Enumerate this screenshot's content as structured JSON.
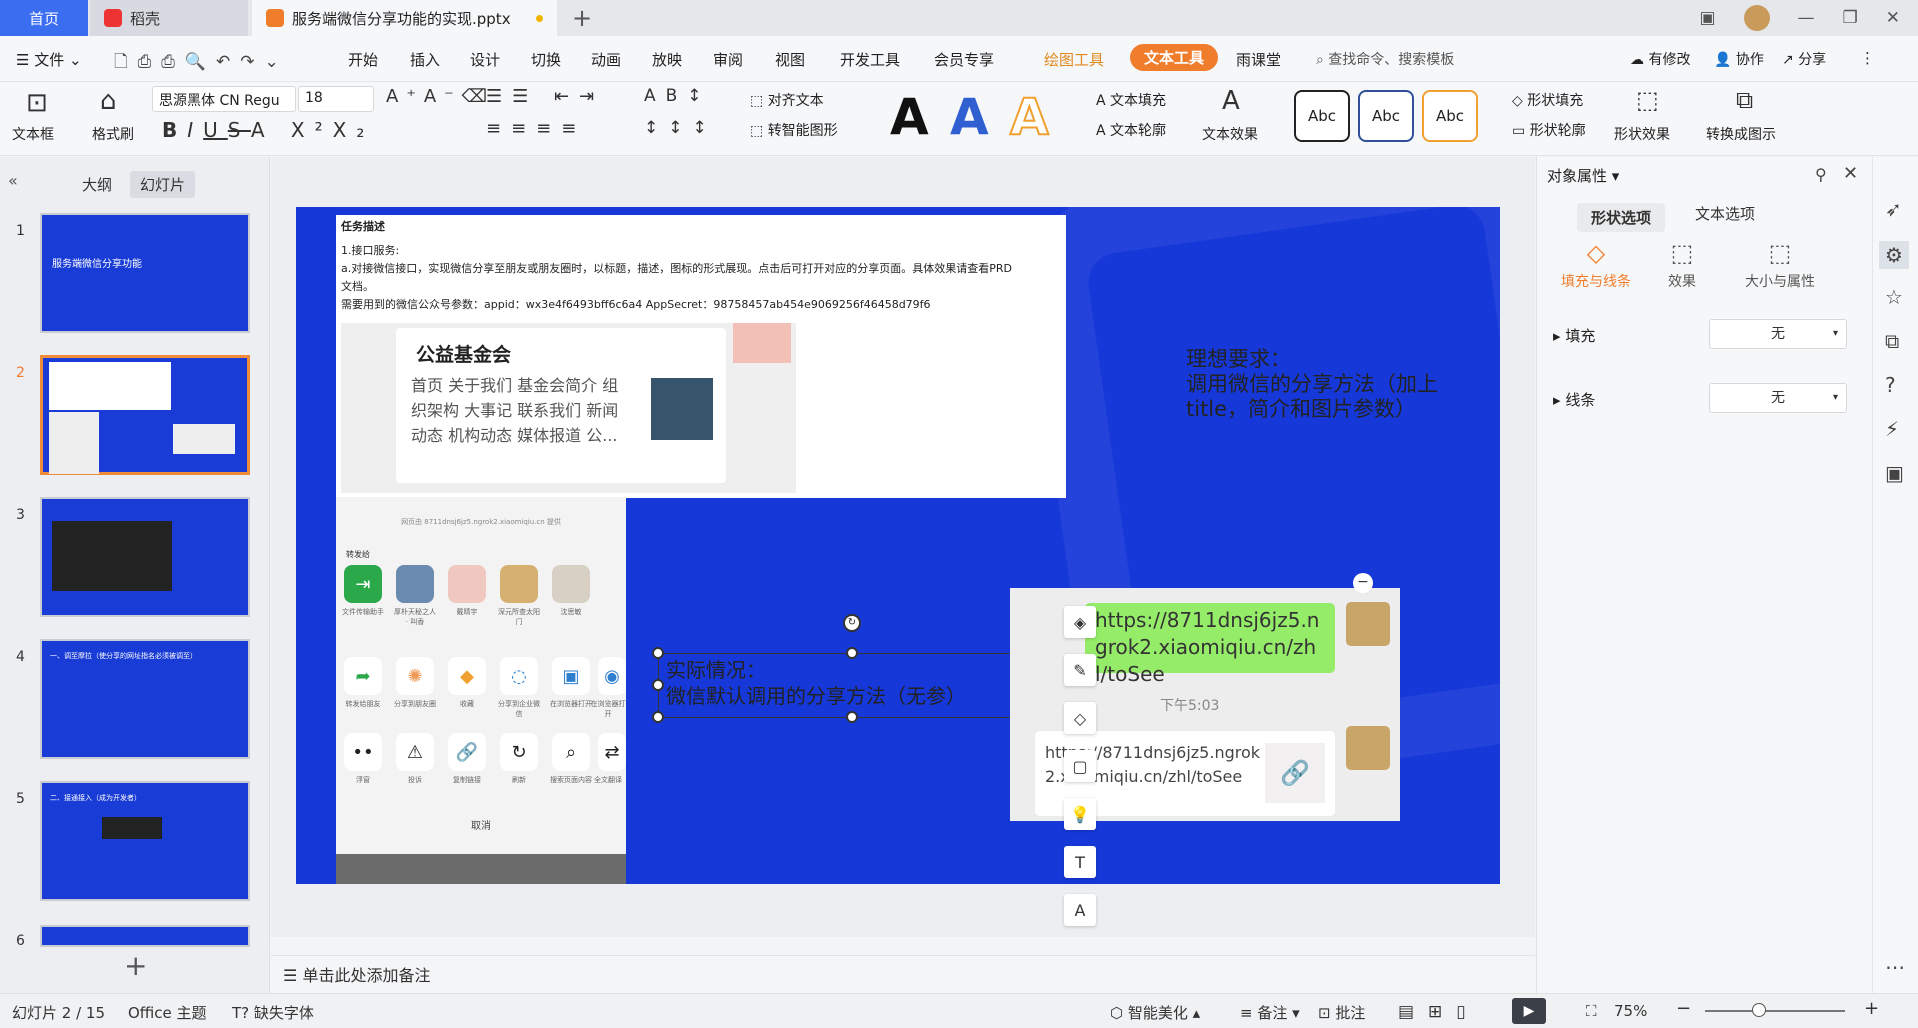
{
  "tabs": {
    "home": "首页",
    "daoke": "稻壳",
    "doc": "服务端微信分享功能的实现.pptx"
  },
  "menubar": {
    "file": "文件",
    "items": [
      "开始",
      "插入",
      "设计",
      "切换",
      "动画",
      "放映",
      "审阅",
      "视图",
      "开发工具",
      "会员专享"
    ],
    "draw_tool": "绘图工具",
    "text_tool": "文本工具",
    "classroom": "雨课堂",
    "search": "查找命令、搜索模板",
    "modified": "有修改",
    "collab": "协作",
    "share": "分享"
  },
  "ribbon": {
    "textbox": "文本框",
    "format_painter": "格式刷",
    "font": "思源黑体 CN Regu",
    "font_size": "18",
    "align_text": "对齐文本",
    "smart_shape": "转智能图形",
    "text_fill": "文本填充",
    "text_outline": "文本轮廓",
    "text_effect": "文本效果",
    "abc": [
      "Abc",
      "Abc",
      "Abc"
    ],
    "shape_fill": "形状填充",
    "shape_outline": "形状轮廓",
    "shape_effect": "形状效果",
    "convert_chart": "转换成图示",
    "big_a": "A"
  },
  "leftpanel": {
    "tab_outline": "大纲",
    "tab_slides": "幻灯片",
    "thumbs": [
      {
        "num": "1",
        "title": "服务端微信分享功能"
      },
      {
        "num": "2",
        "title": ""
      },
      {
        "num": "3",
        "title": ""
      },
      {
        "num": "4",
        "title": "一、调至摩拉（使分享的网址指名必须被调至）"
      },
      {
        "num": "5",
        "title": "二、接通接入（成为开发者）"
      },
      {
        "num": "6",
        "title": ""
      }
    ]
  },
  "slide": {
    "task_title": "任务描述",
    "task_lines": [
      "1.接口服务:",
      "a.对接微信接口，实现微信分享至朋友或朋友圈时，以标题，描述，图标的形式展现。点击后可打开对应的分享页面。具体效果请查看PRD",
      "文档。",
      "需要用到的微信公众号参数：appid：wx3e4f6493bff6c6a4     AppSecret：98758457ab454e9069256f46458d79f6"
    ],
    "wx_title": "公益基金会",
    "wx_lines": [
      "首页 关于我们 基金会简介 组",
      "织架构 大事记 联系我们 新闻",
      "动态 机构动态 媒体报道 公..."
    ],
    "phone_header": "网页由 8711dnsj6jz5.ngrok2.xiaomiqiu.cn 提供",
    "phone_forward": "转发给",
    "phone_contacts": [
      "文件传输助手",
      "厚朴天秘之人 · 叫香",
      "戴晴宇",
      "深元所查太阳门",
      "沈思敏"
    ],
    "phone_actions1": [
      "转发给朋友",
      "分享到朋友圈",
      "收藏",
      "分享到企业微信",
      "在浏览器打开",
      "在浏览器打开"
    ],
    "phone_actions2": [
      "浮窗",
      "投诉",
      "复制链接",
      "刷新",
      "搜索页面内容",
      "全文翻译"
    ],
    "phone_cancel": "取消",
    "ideal_text": "理想要求：\n调用微信的分享方法（加上title，简介和图片参数）",
    "actual_line1": "实际情况：",
    "actual_line2": "微信默认调用的分享方法（无参）",
    "bubble_text": "https://8711dnsj6jz5.ngrok2.xiaomiqiu.cn/zhl/toSee",
    "chat_time": "下午5:03",
    "link_text": "https://8711dnsj6jz5.ngrok2.xiaomiqiu.cn/zhl/toSee"
  },
  "notes": "单击此处添加备注",
  "rightpanel": {
    "title": "对象属性",
    "tab_shape": "形状选项",
    "tab_text": "文本选项",
    "sub_fill": "填充与线条",
    "sub_effect": "效果",
    "sub_size": "大小与属性",
    "fill_label": "填充",
    "fill_value": "无",
    "line_label": "线条",
    "line_value": "无"
  },
  "statusbar": {
    "slide_count": "幻灯片 2 / 15",
    "theme": "Office 主题",
    "missing_font": "缺失字体",
    "beautify": "智能美化",
    "notes": "备注",
    "comment": "批注",
    "zoom": "75%"
  },
  "colors": {
    "accent": "#f07d2c",
    "slide_bg": "#1638d8",
    "home_tab": "#3a6df0"
  }
}
